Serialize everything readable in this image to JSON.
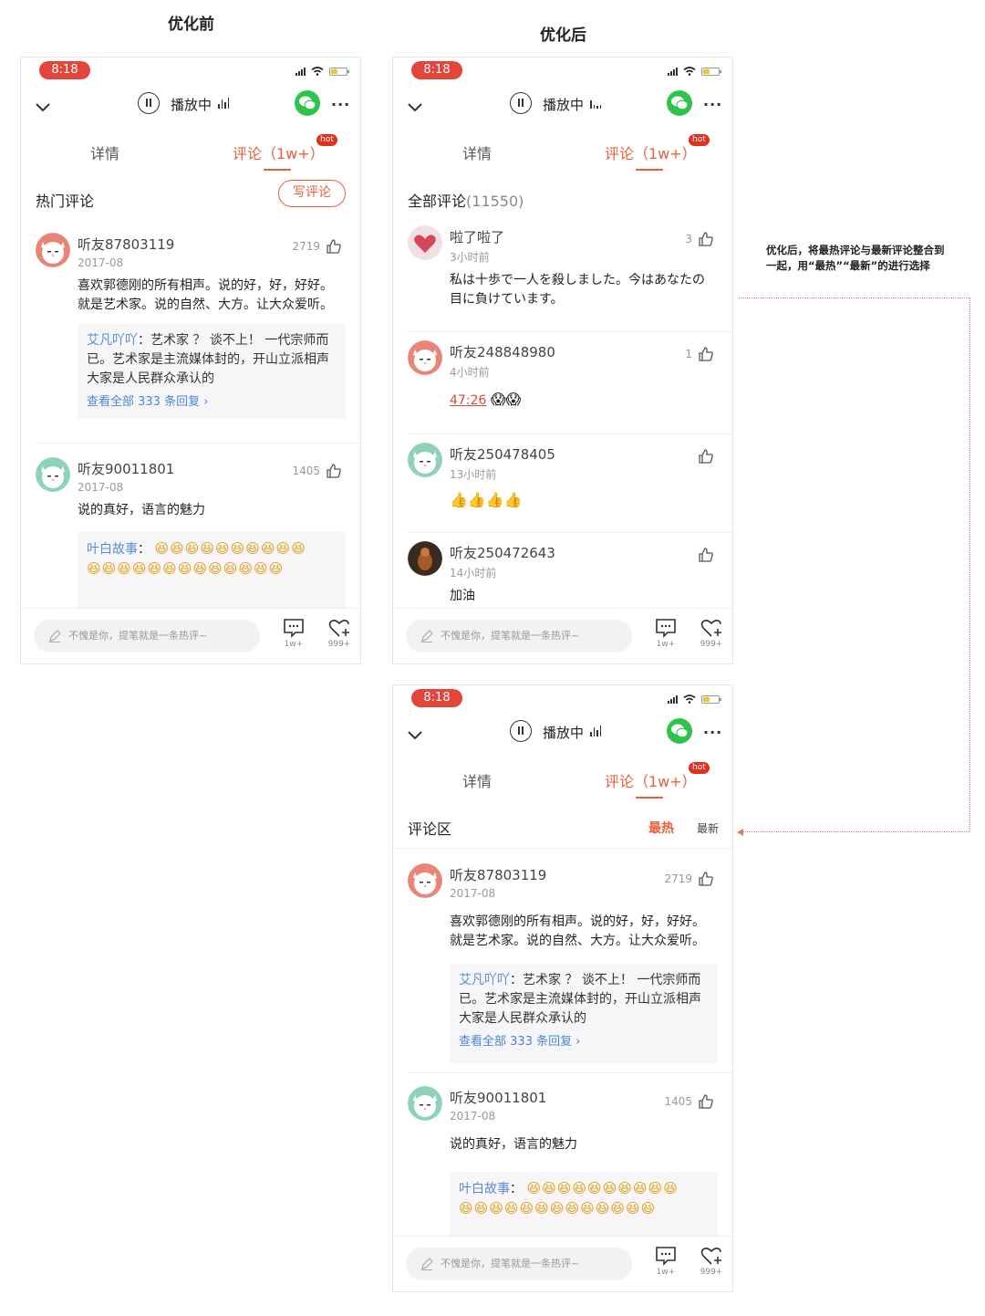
{
  "labels": {
    "before": "优化前",
    "after": "优化后"
  },
  "note": "优化后，将最热评论与最新评论整合到一起，用“最热”“最新”的进行选择",
  "colors": {
    "accent": "#e9603c",
    "time_pill": "#e2463b",
    "link": "#4a86d8",
    "wechat": "#2dc44a"
  },
  "status": {
    "time": "8:18"
  },
  "player": {
    "playing": "播放中"
  },
  "tabs": {
    "detail": "详情",
    "comments": "评论（1w+）",
    "hot": "hot"
  },
  "bottom": {
    "placeholder": "不愧是你，提笔就是一条热评~",
    "comments_count": "1w+",
    "likes_count": "999+"
  },
  "before": {
    "section": "热门评论",
    "write": "写评论",
    "comments": [
      {
        "user": "听友87803119",
        "date": "2017-08",
        "likes": "2719",
        "text": "喜欢郭德刚的所有相声。说的好，好，好好。就是艺术家。说的自然、大方。让大众爱听。",
        "reply_user": "艾凡吖吖",
        "reply_text": "：艺术家 ？ 谈不上！ 一代宗师而已。艺术家是主流媒体封的，开山立派相声大家是人民群众承认的",
        "view_all": "查看全部 333 条回复 ›"
      },
      {
        "user": "听友90011801",
        "date": "2017-08",
        "likes": "1405",
        "text": "说的真好，语言的魅力",
        "reply_user": "叶白故事",
        "reply_text": "："
      }
    ]
  },
  "after_all": {
    "section": "全部评论",
    "count": "(11550)",
    "comments": [
      {
        "user": "啦了啦了",
        "date": "3小时前",
        "likes": "3",
        "text": "私は十歩で一人を殺しました。今はあなたの目に負けています。"
      },
      {
        "user": "听友248848980",
        "date": "4小时前",
        "likes": "1",
        "link": "47:26"
      },
      {
        "user": "听友250478405",
        "date": "13小时前",
        "likes": ""
      },
      {
        "user": "听友250472643",
        "date": "14小时前",
        "likes": "",
        "text": "加油"
      }
    ]
  },
  "after_sorted": {
    "section": "评论区",
    "sort_hot": "最热",
    "sort_new": "最新",
    "comments": [
      {
        "user": "听友87803119",
        "date": "2017-08",
        "likes": "2719",
        "text": "喜欢郭德刚的所有相声。说的好，好，好好。就是艺术家。说的自然、大方。让大众爱听。",
        "reply_user": "艾凡吖吖",
        "reply_text": "：艺术家 ？ 谈不上！ 一代宗师而已。艺术家是主流媒体封的，开山立派相声大家是人民群众承认的",
        "view_all": "查看全部 333 条回复 ›"
      },
      {
        "user": "听友90011801",
        "date": "2017-08",
        "likes": "1405",
        "text": "说的真好，语言的魅力",
        "reply_user": "叶白故事",
        "reply_text": "："
      }
    ]
  }
}
